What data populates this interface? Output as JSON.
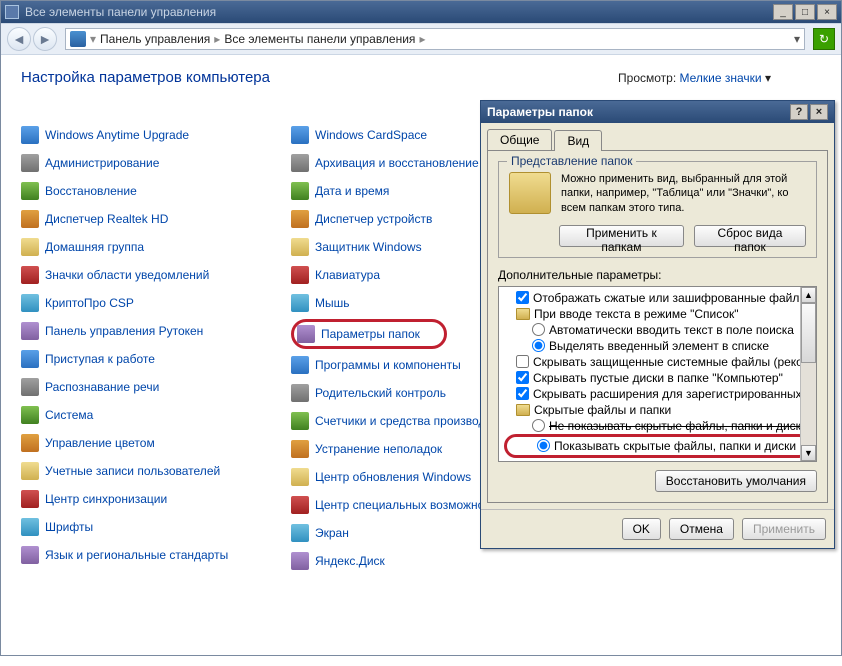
{
  "window": {
    "title": "Все элементы панели управления",
    "breadcrumb": {
      "root": "Панель управления",
      "current": "Все элементы панели управления"
    }
  },
  "heading": "Настройка параметров компьютера",
  "view_by": {
    "label": "Просмотр:",
    "value": "Мелкие значки"
  },
  "items_col1": [
    "Windows Anytime Upgrade",
    "Администрирование",
    "Восстановление",
    "Диспетчер Realtek HD",
    "Домашняя группа",
    "Значки области уведомлений",
    "КриптоПро CSP",
    "Панель управления Рутокен",
    "Приступая к работе",
    "Распознавание речи",
    "Система",
    "Управление цветом",
    "Учетные записи пользователей",
    "Центр синхронизации",
    "Шрифты",
    "Язык и региональные стандарты"
  ],
  "items_col2": [
    "Windows CardSpace",
    "Архивация и восстановление",
    "Дата и время",
    "Диспетчер устройств",
    "Защитник Windows",
    "Клавиатура",
    "Мышь",
    "Параметры папок",
    "Программы и компоненты",
    "Родительский контроль",
    "Счетчики и средства производит",
    "Устранение неполадок",
    "Центр обновления Windows",
    "Центр специальных возможносте",
    "Экран",
    "Яндекс.Диск"
  ],
  "highlighted_item_index": 7,
  "dialog": {
    "title": "Параметры папок",
    "tabs": {
      "general": "Общие",
      "view": "Вид"
    },
    "group": {
      "title": "Представление папок",
      "text": "Можно применить вид, выбранный для этой папки, например, \"Таблица\" или \"Значки\", ко всем папкам этого типа.",
      "apply_btn": "Применить к папкам",
      "reset_btn": "Сброс вида папок"
    },
    "adv_label": "Дополнительные параметры:",
    "tree": [
      {
        "type": "check",
        "checked": true,
        "level": 1,
        "label": "Отображать сжатые или зашифрованные файлы NT"
      },
      {
        "type": "folder",
        "level": 1,
        "label": "При вводе текста в режиме \"Список\""
      },
      {
        "type": "radio",
        "checked": false,
        "level": 2,
        "label": "Автоматически вводить текст в поле поиска"
      },
      {
        "type": "radio",
        "checked": true,
        "level": 2,
        "label": "Выделять введенный элемент в списке"
      },
      {
        "type": "check",
        "checked": false,
        "level": 1,
        "label": "Скрывать защищенные системные файлы (рекомен"
      },
      {
        "type": "check",
        "checked": true,
        "level": 1,
        "label": "Скрывать пустые диски в папке \"Компьютер\""
      },
      {
        "type": "check",
        "checked": true,
        "level": 1,
        "label": "Скрывать расширения для зарегистрированных типо"
      },
      {
        "type": "folder",
        "level": 1,
        "label": "Скрытые файлы и папки"
      },
      {
        "type": "radio",
        "checked": false,
        "level": 2,
        "label": "Не показывать скрытые файлы, папки и диски",
        "struck": true
      },
      {
        "type": "radio",
        "checked": true,
        "level": 2,
        "label": "Показывать скрытые файлы, папки и диски",
        "highlight": true
      }
    ],
    "restore_btn": "Восстановить умолчания",
    "ok": "OK",
    "cancel": "Отмена",
    "apply": "Применить"
  }
}
